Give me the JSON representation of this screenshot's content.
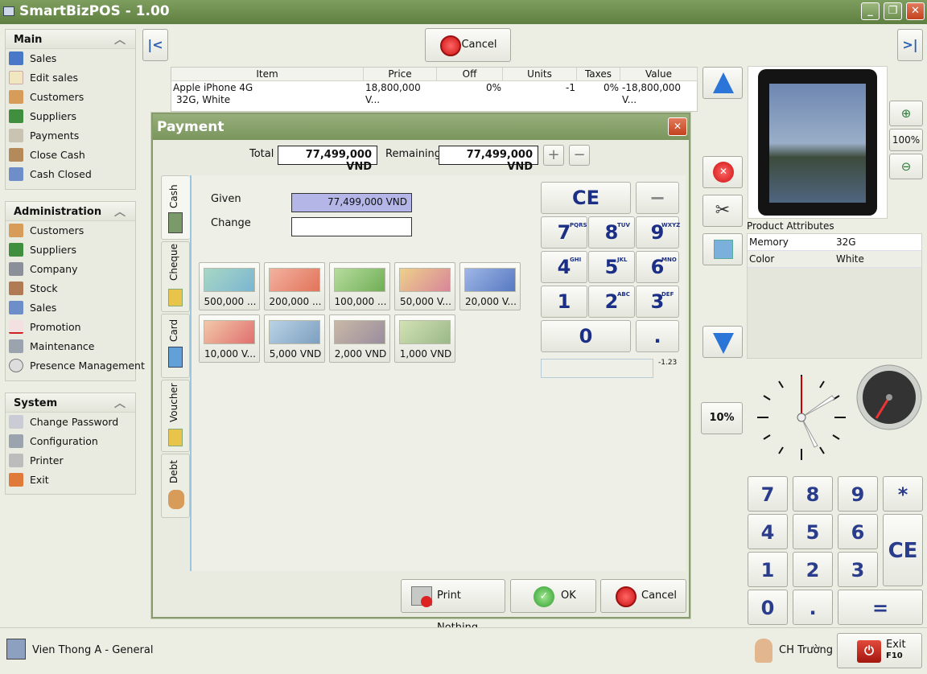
{
  "window": {
    "title": "SmartBizPOS - 1.00",
    "min": "_",
    "max": "❐",
    "close": "✕"
  },
  "sidebar": {
    "main": {
      "title": "Main",
      "items": [
        "Sales",
        "Edit sales",
        "Customers",
        "Suppliers",
        "Payments",
        "Close Cash",
        "Cash Closed"
      ]
    },
    "administration": {
      "title": "Administration",
      "items": [
        "Customers",
        "Suppliers",
        "Company",
        "Stock",
        "Sales",
        "Promotion",
        "Maintenance",
        "Presence Management"
      ]
    },
    "system": {
      "title": "System",
      "items": [
        "Change Password",
        "Configuration",
        "Printer",
        "Exit"
      ]
    }
  },
  "toolbar": {
    "cancel": "Cancel",
    "first": "|<",
    "last": ">|"
  },
  "ticket": {
    "headers": [
      "Item",
      "Price",
      "Off",
      "Units",
      "Taxes",
      "Value"
    ],
    "rows": [
      {
        "item": "Apple iPhone 4G",
        "item2": "32G, White",
        "price": "18,800,000 V...",
        "off": "0%",
        "units": "-1",
        "taxes": "0%",
        "value": "-18,800,000 V..."
      }
    ]
  },
  "zoom": {
    "level": "100%"
  },
  "discount": {
    "label": "10%"
  },
  "attributes": {
    "title": "Product Attributes",
    "rows": [
      {
        "name": "Memory",
        "value": "32G"
      },
      {
        "name": "Color",
        "value": "White"
      }
    ]
  },
  "keypad": {
    "keys": [
      "7",
      "8",
      "9",
      "*",
      "4",
      "5",
      "6",
      "1",
      "2",
      "3",
      "0",
      ".",
      "="
    ],
    "ce": "CE"
  },
  "payment": {
    "title": "Payment",
    "total_label": "Total",
    "total": "77,499,000 VND",
    "remaining_label": "Remaining",
    "remaining": "77,499,000 VND",
    "tabs": [
      "Cash",
      "Cheque",
      "Card",
      "Voucher",
      "Debt"
    ],
    "given_label": "Given",
    "given": "77,499,000 VND",
    "change_label": "Change",
    "change": "",
    "notes": [
      "500,000 ...",
      "200,000 ...",
      "100,000 ...",
      "50,000 V...",
      "20,000 V...",
      "10,000 V...",
      "5,000 VND",
      "2,000 VND",
      "1,000 VND"
    ],
    "pad": {
      "ce": "CE",
      "minus": "−",
      "keys": [
        "7",
        "8",
        "9",
        "4",
        "5",
        "6",
        "1",
        "2",
        "3",
        "0",
        "."
      ],
      "letters": [
        "PQRS",
        "TUV",
        "WXYZ",
        "GHI",
        "JKL",
        "MNO",
        "",
        "ABC",
        "DEF"
      ]
    },
    "display_value": "-1.23",
    "print": "Print Nothing",
    "ok": "OK",
    "cancel": "Cancel"
  },
  "status": {
    "location": "Vien Thong A - General",
    "user": "CH Trường",
    "exit": "Exit",
    "exit_key": "F10"
  }
}
